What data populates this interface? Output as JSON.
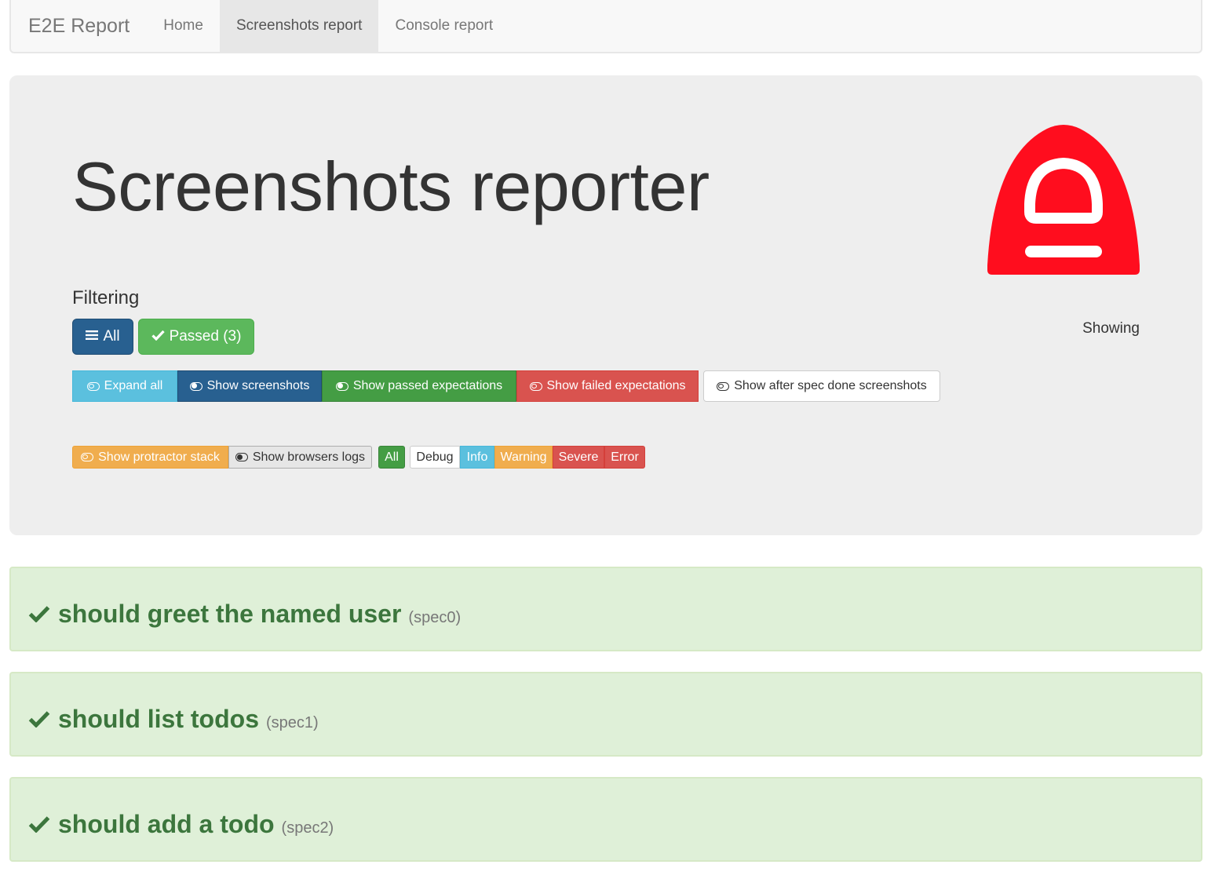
{
  "navbar": {
    "brand": "E2E Report",
    "items": [
      {
        "label": "Home",
        "active": false
      },
      {
        "label": "Screenshots report",
        "active": true
      },
      {
        "label": "Console report",
        "active": false
      }
    ]
  },
  "header": {
    "title": "Screenshots reporter",
    "logo": "protractor-logo-icon"
  },
  "filtering": {
    "label": "Filtering",
    "all_label": "All",
    "passed_label": "Passed (3)",
    "showing_label": "Showing"
  },
  "toggles": {
    "expand_all": "Expand all",
    "show_screenshots": "Show screenshots",
    "show_passed": "Show passed expectations",
    "show_failed": "Show failed expectations",
    "show_after_spec": "Show after spec done screenshots",
    "show_protractor_stack": "Show protractor stack",
    "show_browser_logs": "Show browsers logs"
  },
  "log_levels": [
    "All",
    "Debug",
    "Info",
    "Warning",
    "Severe",
    "Error"
  ],
  "specs": [
    {
      "name": "should greet the named user",
      "id": "(spec0)",
      "status": "passed"
    },
    {
      "name": "should list todos",
      "id": "(spec1)",
      "status": "passed"
    },
    {
      "name": "should add a todo",
      "id": "(spec2)",
      "status": "passed"
    }
  ],
  "colors": {
    "primary": "#2e6da4",
    "success": "#5cb85c",
    "info": "#5bc0de",
    "danger": "#d9534f",
    "warning": "#f0ad4e",
    "logo": "#ff0d1e",
    "spec_bg": "#dff0d8",
    "spec_text": "#3c763d"
  }
}
